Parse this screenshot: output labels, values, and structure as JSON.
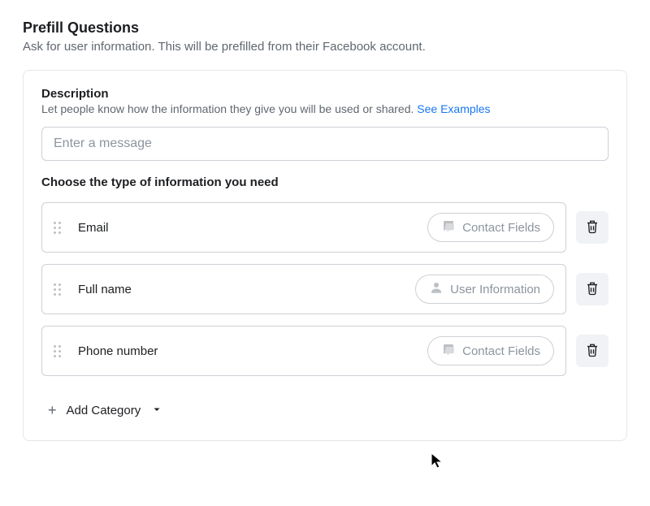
{
  "header": {
    "title": "Prefill Questions",
    "subtitle": "Ask for user information. This will be prefilled from their Facebook account."
  },
  "description": {
    "title": "Description",
    "subtitle_text": "Let people know how the information they give you will be used or shared.",
    "see_examples": "See Examples",
    "message_placeholder": "Enter a message",
    "message_value": ""
  },
  "choose": {
    "title": "Choose the type of information you need"
  },
  "fields": [
    {
      "label": "Email",
      "category": "Contact Fields",
      "icon": "chat"
    },
    {
      "label": "Full name",
      "category": "User Information",
      "icon": "user"
    },
    {
      "label": "Phone number",
      "category": "Contact Fields",
      "icon": "chat"
    }
  ],
  "add_category": {
    "label": "Add Category"
  }
}
